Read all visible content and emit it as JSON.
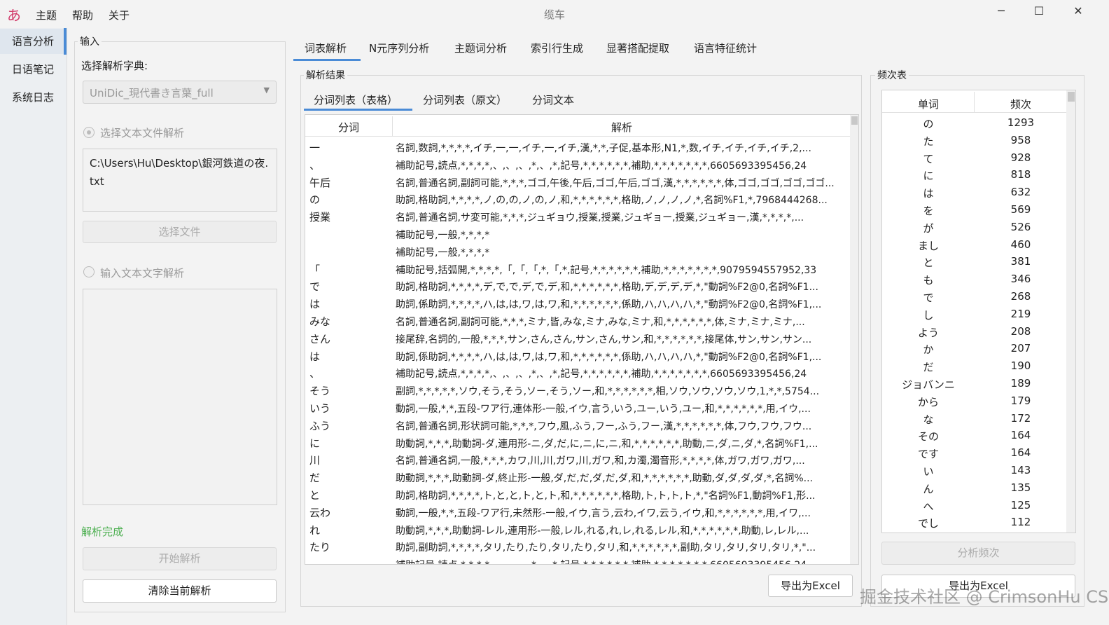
{
  "app": {
    "icon_char": "あ",
    "menu": [
      "主题",
      "帮助",
      "关于"
    ],
    "title": "缆车",
    "window_controls": {
      "minimize": "─",
      "maximize": "☐",
      "close": "✕"
    }
  },
  "nav": {
    "items": [
      "语言分析",
      "日语笔记",
      "系统日志"
    ],
    "active_index": 0
  },
  "input_panel": {
    "group_title": "输入",
    "dict_label": "选择解析字典:",
    "dict_value": "UniDic_現代書き言葉_full",
    "radio_file_label": "选择文本文件解析",
    "file_path": "C:\\Users\\Hu\\Desktop\\銀河鉄道の夜.txt",
    "choose_file_button": "选择文件",
    "radio_text_label": "输入文本文字解析",
    "text_input_value": "",
    "status": "解析完成",
    "status_color": "#4caf50",
    "start_button": "开始解析",
    "clear_button": "清除当前解析"
  },
  "tabs": [
    "词表解析",
    "N元序列分析",
    "主题词分析",
    "索引行生成",
    "显著搭配提取",
    "语言特征统计"
  ],
  "active_tab": 0,
  "results": {
    "group_title": "解析结果",
    "subtabs": [
      "分词列表（表格）",
      "分词列表（原文）",
      "分词文本"
    ],
    "active_subtab": 0,
    "columns": [
      "分词",
      "解析"
    ],
    "rows": [
      [
        "一",
        "名詞,数詞,*,*,*,*,イチ,一,一,イチ,一,イチ,漢,*,*,子促,基本形,N1,*,数,イチ,イチ,イチ,イチ,2,..."
      ],
      [
        "、",
        "補助記号,読点,*,*,*,*,、,、,、,*,、,*,記号,*,*,*,*,*,*,補助,*,*,*,*,*,*,*,6605693395456,24"
      ],
      [
        "午后",
        "名詞,普通名詞,副詞可能,*,*,*,ゴゴ,午後,午后,ゴゴ,午后,ゴゴ,漢,*,*,*,*,*,*,体,ゴゴ,ゴゴ,ゴゴ,ゴゴ..."
      ],
      [
        "の",
        "助詞,格助詞,*,*,*,*,ノ,の,の,ノ,の,ノ,和,*,*,*,*,*,*,格助,ノ,ノ,ノ,ノ,*,名詞%F1,*,7968444268..."
      ],
      [
        "授業",
        "名詞,普通名詞,サ変可能,*,*,*,ジュギョウ,授業,授業,ジュギョー,授業,ジュギョー,漢,*,*,*,*,..."
      ],
      [
        "",
        "補助記号,一般,*,*,*,*"
      ],
      [
        "",
        "補助記号,一般,*,*,*,*"
      ],
      [
        "「",
        "補助記号,括弧開,*,*,*,*,「,「,「,*,「,*,記号,*,*,*,*,*,*,補助,*,*,*,*,*,*,*,9079594557952,33"
      ],
      [
        "で",
        "助詞,格助詞,*,*,*,*,デ,で,で,デ,で,デ,和,*,*,*,*,*,*,格助,デ,デ,デ,デ,*,\"動詞%F2@0,名詞%F1..."
      ],
      [
        "は",
        "助詞,係助詞,*,*,*,*,ハ,は,は,ワ,は,ワ,和,*,*,*,*,*,*,係助,ハ,ハ,ハ,ハ,*,\"動詞%F2@0,名詞%F1,..."
      ],
      [
        "みな",
        "名詞,普通名詞,副詞可能,*,*,*,ミナ,皆,みな,ミナ,みな,ミナ,和,*,*,*,*,*,*,体,ミナ,ミナ,ミナ,..."
      ],
      [
        "さん",
        "接尾辞,名詞的,一般,*,*,*,サン,さん,さん,サン,さん,サン,和,*,*,*,*,*,*,接尾体,サン,サン,サン..."
      ],
      [
        "は",
        "助詞,係助詞,*,*,*,*,ハ,は,は,ワ,は,ワ,和,*,*,*,*,*,*,係助,ハ,ハ,ハ,ハ,*,\"動詞%F2@0,名詞%F1,..."
      ],
      [
        "、",
        "補助記号,読点,*,*,*,*,、,、,、,*,、,*,記号,*,*,*,*,*,*,補助,*,*,*,*,*,*,*,6605693395456,24"
      ],
      [
        "そう",
        "副詞,*,*,*,*,*,ソウ,そう,そう,ソー,そう,ソー,和,*,*,*,*,*,*,相,ソウ,ソウ,ソウ,ソウ,1,*,*,5754..."
      ],
      [
        "いう",
        "動詞,一般,*,*,五段-ワア行,連体形-一般,イウ,言う,いう,ユー,いう,ユー,和,*,*,*,*,*,*,用,イウ,..."
      ],
      [
        "ふう",
        "名詞,普通名詞,形状詞可能,*,*,*,フウ,風,ふう,フー,ふう,フー,漢,*,*,*,*,*,*,体,フウ,フウ,フウ..."
      ],
      [
        "に",
        "助動詞,*,*,*,助動詞-ダ,連用形-ニ,ダ,だ,に,ニ,に,ニ,和,*,*,*,*,*,*,助動,ニ,ダ,ニ,ダ,*,名詞%F1,..."
      ],
      [
        "川",
        "名詞,普通名詞,一般,*,*,*,カワ,川,川,ガワ,川,ガワ,和,カ濁,濁音形,*,*,*,*,体,ガワ,ガワ,ガワ,..."
      ],
      [
        "だ",
        "助動詞,*,*,*,助動詞-ダ,終止形-一般,ダ,だ,だ,ダ,だ,ダ,和,*,*,*,*,*,*,助動,ダ,ダ,ダ,ダ,*,名詞%..."
      ],
      [
        "と",
        "助詞,格助詞,*,*,*,*,ト,と,と,ト,と,ト,和,*,*,*,*,*,*,格助,ト,ト,ト,ト,*,\"名詞%F1,動詞%F1,形..."
      ],
      [
        "云わ",
        "動詞,一般,*,*,五段-ワア行,未然形-一般,イウ,言う,云わ,イワ,云う,イウ,和,*,*,*,*,*,*,用,イワ,..."
      ],
      [
        "れ",
        "助動詞,*,*,*,助動詞-レル,連用形-一般,レル,れる,れ,レ,れる,レル,和,*,*,*,*,*,*,助動,レ,レル,..."
      ],
      [
        "たり",
        "助詞,副助詞,*,*,*,*,タリ,たり,たり,タリ,たり,タリ,和,*,*,*,*,*,*,副助,タリ,タリ,タリ,タリ,*,\"..."
      ],
      [
        "",
        "補助記号,読点,*,*,*,*,、,、,、,*,、,*,記号,*,*,*,*,*,*,補助,*,*,*,*,*,*,*,6605693395456,24"
      ]
    ],
    "export_button": "导出为Excel"
  },
  "frequency": {
    "group_title": "频次表",
    "columns": [
      "单词",
      "频次"
    ],
    "rows": [
      [
        "の",
        "1293"
      ],
      [
        "た",
        "958"
      ],
      [
        "て",
        "928"
      ],
      [
        "に",
        "818"
      ],
      [
        "は",
        "632"
      ],
      [
        "を",
        "569"
      ],
      [
        "が",
        "526"
      ],
      [
        "まし",
        "460"
      ],
      [
        "と",
        "381"
      ],
      [
        "も",
        "346"
      ],
      [
        "で",
        "268"
      ],
      [
        "し",
        "219"
      ],
      [
        "よう",
        "208"
      ],
      [
        "か",
        "207"
      ],
      [
        "だ",
        "190"
      ],
      [
        "ジョバンニ",
        "189"
      ],
      [
        "から",
        "179"
      ],
      [
        "な",
        "172"
      ],
      [
        "その",
        "164"
      ],
      [
        "です",
        "164"
      ],
      [
        "い",
        "143"
      ],
      [
        "ん",
        "135"
      ],
      [
        "へ",
        "125"
      ],
      [
        "でし",
        "112"
      ]
    ],
    "analyze_button": "分析频次",
    "export_button": "导出为Excel"
  },
  "watermark": "掘金技术社区 @ CrimsonHu  CSDN @Java八股文面试"
}
